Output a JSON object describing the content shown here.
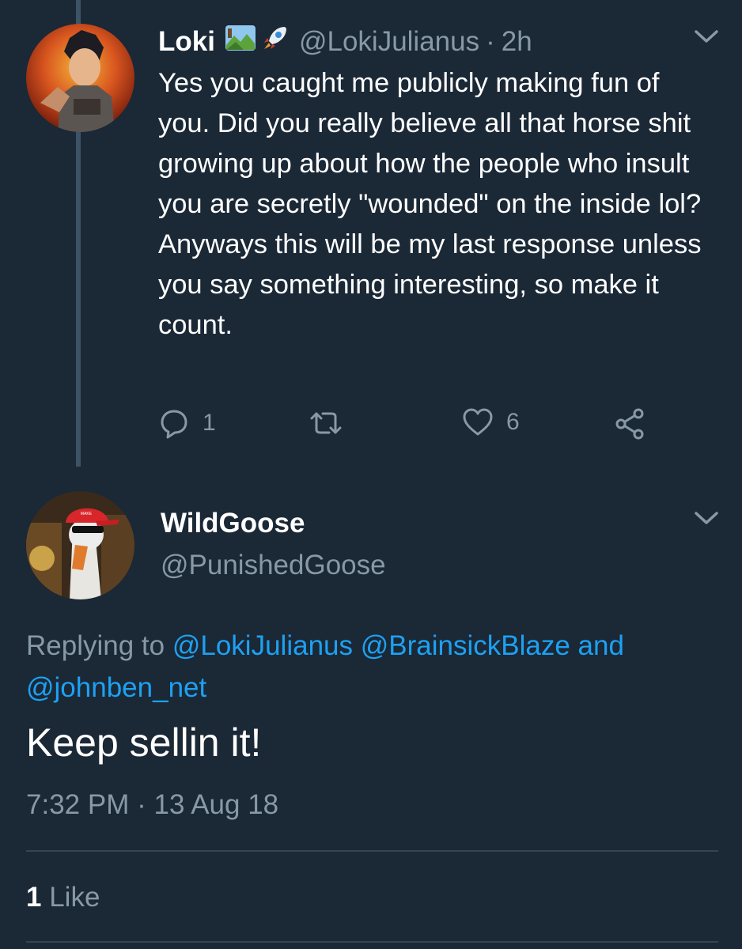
{
  "tweet1": {
    "name": "Loki",
    "emoji_icons": [
      "landscape-emoji-icon",
      "rocket-emoji-icon"
    ],
    "handle": "@LokiJulianus",
    "separator": "·",
    "time": "2h",
    "text": "Yes you caught me publicly making fun of you. Did you really believe all that horse shit growing up about how the people who insult you are secretly \"wounded\" on the inside lol? Anyways this will be my last response unless you say something interesting, so make it count.",
    "reply_count": "1",
    "like_count": "6"
  },
  "tweet2": {
    "name": "WildGoose",
    "handle": "@PunishedGoose",
    "replying_label": "Replying to",
    "replying_to_1": "@LokiJulianus",
    "replying_to_2": "@BrainsickBlaze",
    "replying_and": "and",
    "replying_to_3": "@johnben_net",
    "text": "Keep sellin it!",
    "time": "7:32 PM",
    "separator": "·",
    "date": "13 Aug 18",
    "likes_count": "1",
    "likes_label": "Like"
  },
  "colors": {
    "background": "#1b2836",
    "text_primary": "#ffffff",
    "text_secondary": "#8899a6",
    "link": "#1da1f2",
    "divider": "#38444d"
  }
}
